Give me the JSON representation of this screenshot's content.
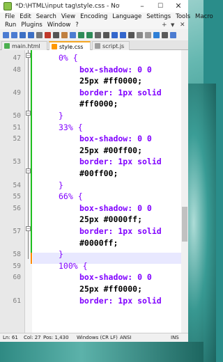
{
  "window": {
    "title": "*D:\\HTML\\input tag\\style.css - Notepad++",
    "controls": {
      "minimize": "–",
      "maximize": "☐",
      "close": "✕"
    }
  },
  "menu": {
    "row1": [
      "File",
      "Edit",
      "Search",
      "View",
      "Encoding",
      "Language",
      "Settings",
      "Tools",
      "Macro"
    ],
    "row2": [
      "Run",
      "Plugins",
      "Window",
      "?"
    ],
    "right": {
      "plus": "+",
      "down": "▼",
      "close": "✕"
    }
  },
  "tabs": [
    {
      "label": "main.html",
      "color": "#4caf50"
    },
    {
      "label": "style.css",
      "color": "#ff9800"
    },
    {
      "label": "script.js",
      "color": "#9e9e9e"
    }
  ],
  "editor": {
    "lines": [
      {
        "no": "47",
        "text": "0% {",
        "kind": "sel"
      },
      {
        "no": "48",
        "text": "box-shadow: 0 0",
        "kind": "prop"
      },
      {
        "no": "",
        "text": "25px #ff0000;",
        "kind": "val"
      },
      {
        "no": "49",
        "text": "border: 1px solid",
        "kind": "prop"
      },
      {
        "no": "",
        "text": "#ff0000;",
        "kind": "val"
      },
      {
        "no": "50",
        "text": "}",
        "kind": "sel"
      },
      {
        "no": "51",
        "text": "33% {",
        "kind": "sel"
      },
      {
        "no": "52",
        "text": "box-shadow: 0 0",
        "kind": "prop"
      },
      {
        "no": "",
        "text": "25px #00ff00;",
        "kind": "val"
      },
      {
        "no": "53",
        "text": "border: 1px solid",
        "kind": "prop"
      },
      {
        "no": "",
        "text": "#00ff00;",
        "kind": "val"
      },
      {
        "no": "54",
        "text": "}",
        "kind": "sel"
      },
      {
        "no": "55",
        "text": "66% {",
        "kind": "sel"
      },
      {
        "no": "56",
        "text": "box-shadow: 0 0",
        "kind": "prop"
      },
      {
        "no": "",
        "text": "25px #0000ff;",
        "kind": "val"
      },
      {
        "no": "57",
        "text": "border: 1px solid",
        "kind": "prop"
      },
      {
        "no": "",
        "text": "#0000ff;",
        "kind": "val"
      },
      {
        "no": "58",
        "text": "}",
        "kind": "sel"
      },
      {
        "no": "59",
        "text": "100% {",
        "kind": "sel"
      },
      {
        "no": "60",
        "text": "box-shadow: 0 0",
        "kind": "prop"
      },
      {
        "no": "",
        "text": "25px #ff0000;",
        "kind": "val"
      },
      {
        "no": "61",
        "text": "border: 1px solid",
        "kind": "prop"
      }
    ]
  },
  "status": {
    "ln": "Ln: 61",
    "col": "Col: 27",
    "pos": "Pos: 1,430",
    "eol": "Windows (CR LF)",
    "encoding": "ANSI",
    "mode": "INS"
  }
}
